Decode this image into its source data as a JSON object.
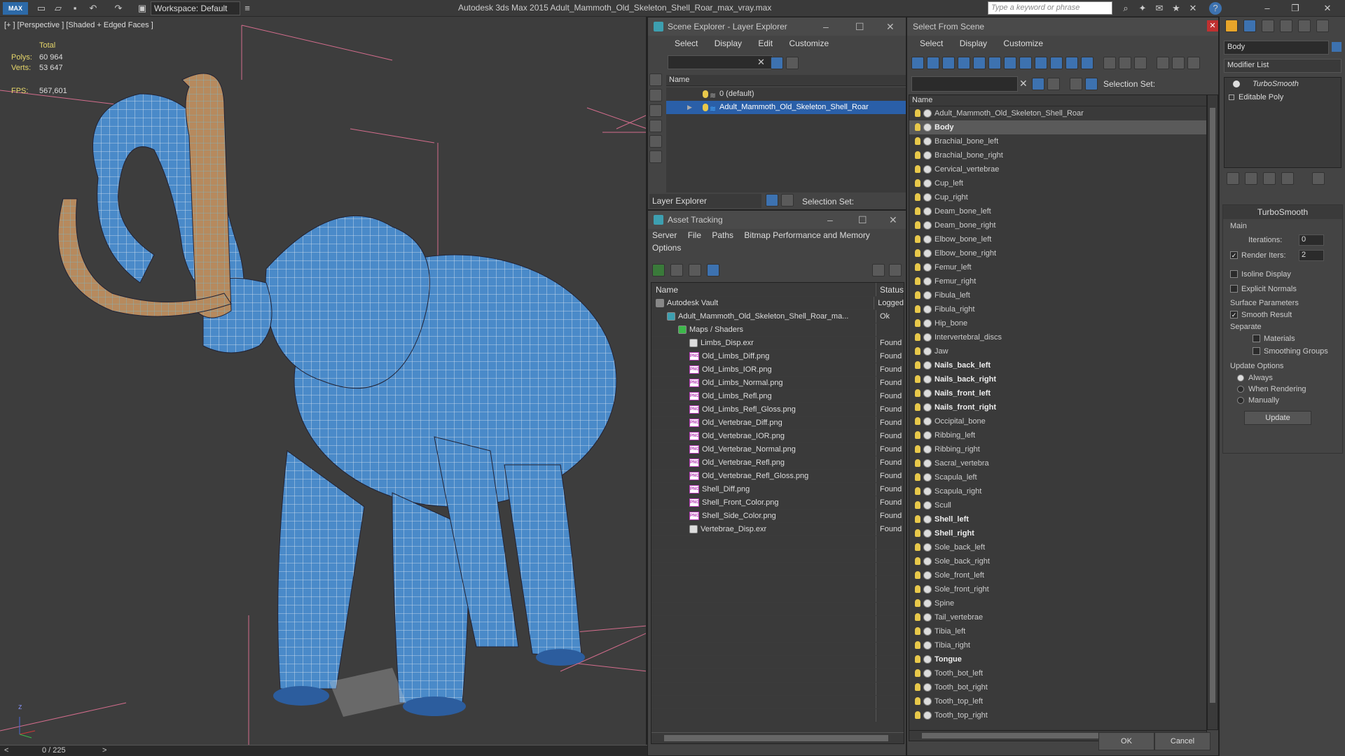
{
  "app": {
    "logo": "MAX",
    "title": "Autodesk 3ds Max  2015     Adult_Mammoth_Old_Skeleton_Shell_Roar_max_vray.max",
    "workspace": "Workspace: Default",
    "search_placeholder": "Type a keyword or phrase"
  },
  "viewport": {
    "label": "[+ ] [Perspective ] [Shaded + Edged Faces ]",
    "stats": {
      "total_label": "Total",
      "polys_label": "Polys:",
      "polys": "60 964",
      "verts_label": "Verts:",
      "verts": "53 647",
      "fps_label": "FPS:",
      "fps": "567,601"
    },
    "axis_z": "z",
    "timeline": "0 / 225",
    "prev": "<",
    "next": ">"
  },
  "scene_explorer": {
    "title": "Scene Explorer - Layer Explorer",
    "menu": [
      "Select",
      "Display",
      "Edit",
      "Customize"
    ],
    "column": "Name",
    "layers": [
      "0 (default)",
      "Adult_Mammoth_Old_Skeleton_Shell_Roar"
    ],
    "footer_dropdown": "Layer Explorer",
    "selection_set": "Selection Set:"
  },
  "asset_tracking": {
    "title": "Asset Tracking",
    "menu": [
      "Server",
      "File",
      "Paths",
      "Bitmap Performance and Memory"
    ],
    "menu2": "Options",
    "col_name": "Name",
    "col_status": "Status",
    "rows": [
      {
        "name": "Autodesk Vault",
        "status": "Logged",
        "indent": 0,
        "icon": "vault"
      },
      {
        "name": "Adult_Mammoth_Old_Skeleton_Shell_Roar_ma...",
        "status": "Ok",
        "indent": 1,
        "icon": "max"
      },
      {
        "name": "Maps / Shaders",
        "status": "",
        "indent": 2,
        "icon": "maps"
      },
      {
        "name": "Limbs_Disp.exr",
        "status": "Found",
        "indent": 3,
        "icon": "exr"
      },
      {
        "name": "Old_Limbs_Diff.png",
        "status": "Found",
        "indent": 3,
        "icon": "png"
      },
      {
        "name": "Old_Limbs_IOR.png",
        "status": "Found",
        "indent": 3,
        "icon": "png"
      },
      {
        "name": "Old_Limbs_Normal.png",
        "status": "Found",
        "indent": 3,
        "icon": "png"
      },
      {
        "name": "Old_Limbs_Refl.png",
        "status": "Found",
        "indent": 3,
        "icon": "png"
      },
      {
        "name": "Old_Limbs_Refl_Gloss.png",
        "status": "Found",
        "indent": 3,
        "icon": "png"
      },
      {
        "name": "Old_Vertebrae_Diff.png",
        "status": "Found",
        "indent": 3,
        "icon": "png"
      },
      {
        "name": "Old_Vertebrae_IOR.png",
        "status": "Found",
        "indent": 3,
        "icon": "png"
      },
      {
        "name": "Old_Vertebrae_Normal.png",
        "status": "Found",
        "indent": 3,
        "icon": "png"
      },
      {
        "name": "Old_Vertebrae_Refl.png",
        "status": "Found",
        "indent": 3,
        "icon": "png"
      },
      {
        "name": "Old_Vertebrae_Refl_Gloss.png",
        "status": "Found",
        "indent": 3,
        "icon": "png"
      },
      {
        "name": "Shell_Diff.png",
        "status": "Found",
        "indent": 3,
        "icon": "png"
      },
      {
        "name": "Shell_Front_Color.png",
        "status": "Found",
        "indent": 3,
        "icon": "png"
      },
      {
        "name": "Shell_Side_Color.png",
        "status": "Found",
        "indent": 3,
        "icon": "png"
      },
      {
        "name": "Vertebrae_Disp.exr",
        "status": "Found",
        "indent": 3,
        "icon": "exr"
      }
    ]
  },
  "select_from_scene": {
    "title": "Select From Scene",
    "menu": [
      "Select",
      "Display",
      "Customize"
    ],
    "selection_set": "Selection Set:",
    "column": "Name",
    "items": [
      {
        "name": "Adult_Mammoth_Old_Skeleton_Shell_Roar",
        "bold": false,
        "selected": false
      },
      {
        "name": "Body",
        "bold": true,
        "selected": true
      },
      {
        "name": "Brachial_bone_left",
        "bold": false
      },
      {
        "name": "Brachial_bone_right",
        "bold": false
      },
      {
        "name": "Cervical_vertebrae",
        "bold": false
      },
      {
        "name": "Cup_left",
        "bold": false
      },
      {
        "name": "Cup_right",
        "bold": false
      },
      {
        "name": "Deam_bone_left",
        "bold": false
      },
      {
        "name": "Deam_bone_right",
        "bold": false
      },
      {
        "name": "Elbow_bone_left",
        "bold": false
      },
      {
        "name": "Elbow_bone_right",
        "bold": false
      },
      {
        "name": "Femur_left",
        "bold": false
      },
      {
        "name": "Femur_right",
        "bold": false
      },
      {
        "name": "Fibula_left",
        "bold": false
      },
      {
        "name": "Fibula_right",
        "bold": false
      },
      {
        "name": "Hip_bone",
        "bold": false
      },
      {
        "name": "Intervertebral_discs",
        "bold": false
      },
      {
        "name": "Jaw",
        "bold": false
      },
      {
        "name": "Nails_back_left",
        "bold": true
      },
      {
        "name": "Nails_back_right",
        "bold": true
      },
      {
        "name": "Nails_front_left",
        "bold": true
      },
      {
        "name": "Nails_front_right",
        "bold": true
      },
      {
        "name": "Occipital_bone",
        "bold": false
      },
      {
        "name": "Ribbing_left",
        "bold": false
      },
      {
        "name": "Ribbing_right",
        "bold": false
      },
      {
        "name": "Sacral_vertebra",
        "bold": false
      },
      {
        "name": "Scapula_left",
        "bold": false
      },
      {
        "name": "Scapula_right",
        "bold": false
      },
      {
        "name": "Scull",
        "bold": false
      },
      {
        "name": "Shell_left",
        "bold": true
      },
      {
        "name": "Shell_right",
        "bold": true
      },
      {
        "name": "Sole_back_left",
        "bold": false
      },
      {
        "name": "Sole_back_right",
        "bold": false
      },
      {
        "name": "Sole_front_left",
        "bold": false
      },
      {
        "name": "Sole_front_right",
        "bold": false
      },
      {
        "name": "Spine",
        "bold": false
      },
      {
        "name": "Tail_vertebrae",
        "bold": false
      },
      {
        "name": "Tibia_left",
        "bold": false
      },
      {
        "name": "Tibia_right",
        "bold": false
      },
      {
        "name": "Tongue",
        "bold": true
      },
      {
        "name": "Tooth_bot_left",
        "bold": false
      },
      {
        "name": "Tooth_bot_right",
        "bold": false
      },
      {
        "name": "Tooth_top_left",
        "bold": false
      },
      {
        "name": "Tooth_top_right",
        "bold": false
      }
    ],
    "ok": "OK",
    "cancel": "Cancel"
  },
  "command_panel": {
    "object_name": "Body",
    "modifier_list": "Modifier List",
    "stack": [
      "TurboSmooth",
      "Editable Poly"
    ],
    "rollout_title": "TurboSmooth",
    "main_label": "Main",
    "iterations_label": "Iterations:",
    "iterations": "0",
    "render_iters_label": "Render Iters:",
    "render_iters": "2",
    "isoline": "Isoline Display",
    "explicit_normals": "Explicit Normals",
    "surface_params": "Surface Parameters",
    "smooth_result": "Smooth Result",
    "separate": "Separate",
    "materials": "Materials",
    "smoothing_groups": "Smoothing Groups",
    "update_options": "Update Options",
    "always": "Always",
    "when_rendering": "When Rendering",
    "manually": "Manually",
    "update_button": "Update"
  }
}
